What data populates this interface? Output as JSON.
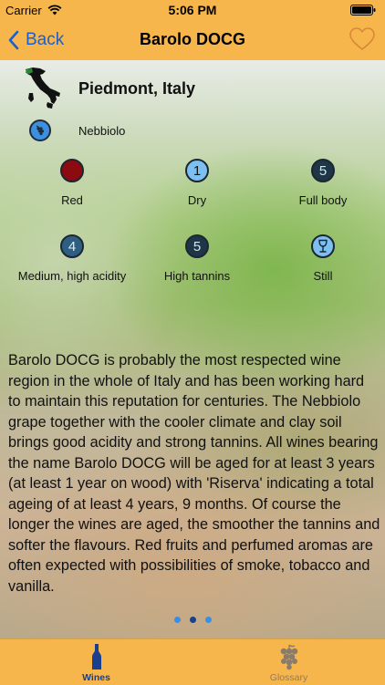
{
  "status_bar": {
    "carrier": "Carrier",
    "time": "5:06 PM"
  },
  "nav": {
    "back_label": "Back",
    "title": "Barolo DOCG",
    "favorite_icon": "heart-outline-icon"
  },
  "region": {
    "name": "Piedmont, Italy",
    "map_icon": "italy-map-icon"
  },
  "grape": {
    "name": "Nebbiolo",
    "icon": "grape-icon"
  },
  "attributes": [
    {
      "id": "color",
      "label": "Red",
      "value": "",
      "fill": "#8b0b10"
    },
    {
      "id": "sweetness",
      "label": "Dry",
      "value": "1",
      "fill": "#7cc0f2"
    },
    {
      "id": "body",
      "label": "Full body",
      "value": "5",
      "fill": "#1e3646"
    },
    {
      "id": "acidity",
      "label": "Medium, high acidity",
      "value": "4",
      "fill": "#2f5f80"
    },
    {
      "id": "tannins",
      "label": "High tannins",
      "value": "5",
      "fill": "#1e3646"
    },
    {
      "id": "type",
      "label": "Still",
      "value": "",
      "fill": "#7cc0f2"
    }
  ],
  "description": "Barolo DOCG is probably the most respected wine region in the whole of Italy and has been working hard to maintain this reputation for centuries. The Nebbiolo grape together with the cooler climate and clay soil brings good acidity and strong tannins. All wines bearing the name Barolo DOCG will be aged for at least 3 years (at least 1 year on wood) with 'Riserva' indicating a total ageing of at least 4 years, 9 months. Of course the longer the wines are aged, the smoother the tannins and softer the flavours. Red fruits and perfumed aromas are often expected with possibilities of smoke, tobacco and vanilla.",
  "pager": {
    "total": 3,
    "current": 2
  },
  "tabs": [
    {
      "label": "Wines",
      "icon": "wine-bottle-icon",
      "active": true
    },
    {
      "label": "Glossary",
      "icon": "grapes-icon",
      "active": false
    }
  ],
  "colors": {
    "bar_background": "#f7b64b",
    "accent_blue": "#1a5fd0",
    "active_tab": "#1a3f8f"
  }
}
